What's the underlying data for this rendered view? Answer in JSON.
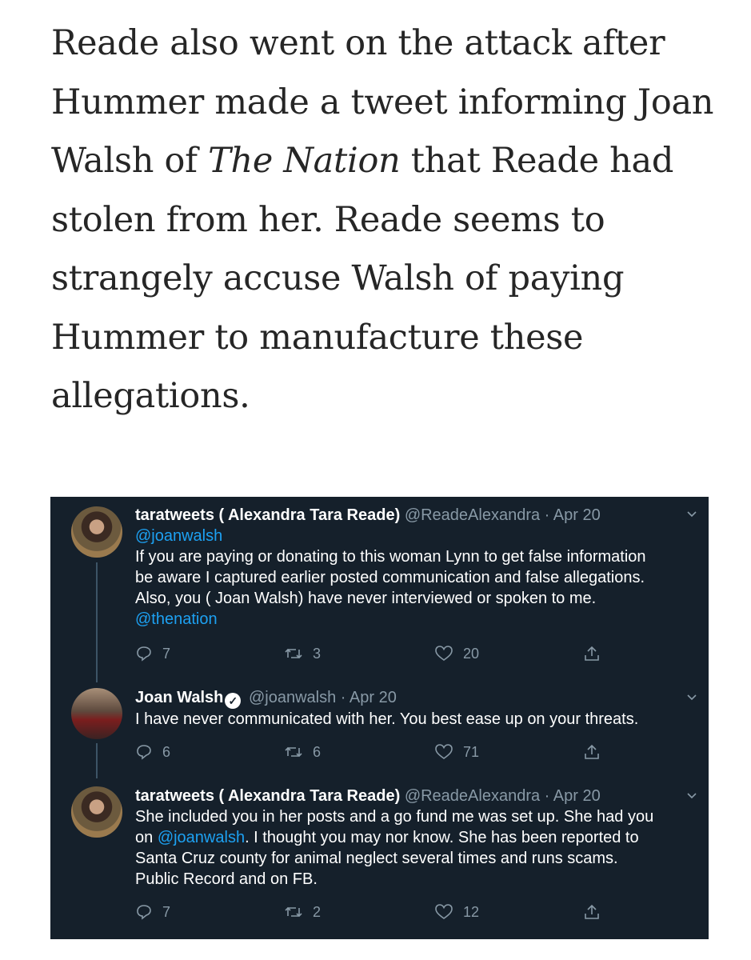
{
  "article": {
    "line1": "Reade also went on the attack after",
    "line2": "Hummer made a tweet informing Joan",
    "line3_pre": "Walsh of ",
    "line3_em": "The Nation",
    "line3_post": " that Reade had",
    "line4": "stolen from her. Reade seems to",
    "line5": "strangely accuse Walsh of paying",
    "line6": "Hummer to manufacture these",
    "line7": "allegations."
  },
  "tweets": [
    {
      "name": "taratweets ( Alexandra Tara Reade)",
      "handle": "@ReadeAlexandra",
      "dot": "·",
      "date": "Apr 20",
      "mention_top": "@joanwalsh",
      "body1": "If you are paying or donating to this woman Lynn to get false information",
      "body2": "be aware I captured earlier posted communication and false allegations.",
      "body3": "Also, you ( Joan Walsh)  have never interviewed or spoken to me.",
      "mention_bottom": "@thenation",
      "replies": "7",
      "retweets": "3",
      "likes": "20"
    },
    {
      "name": "Joan Walsh",
      "handle": "@joanwalsh",
      "dot": "·",
      "date": "Apr 20",
      "body1": "I have never communicated with her. You best ease up on your threats.",
      "replies": "6",
      "retweets": "6",
      "likes": "71"
    },
    {
      "name": "taratweets ( Alexandra Tara Reade)",
      "handle": "@ReadeAlexandra",
      "dot": "·",
      "date": "Apr 20",
      "body1": "She included you in her posts and a go fund me was set up. She had you",
      "body2_pre": "on ",
      "body2_mention": "@joanwalsh",
      "body2_post": ". I thought you may nor know. She has been reported to",
      "body3": "Santa Cruz county for animal neglect several times and runs scams.",
      "body4": "Public Record and on FB.",
      "replies": "7",
      "retweets": "2",
      "likes": "12"
    }
  ],
  "colors": {
    "card_bg": "#15202b",
    "link": "#1da1f2",
    "muted": "#8899a6",
    "thread_line": "#3d5466"
  },
  "icons": [
    "reply-icon",
    "retweet-icon",
    "like-icon",
    "share-icon",
    "chevron-down-icon",
    "verified-badge-icon"
  ]
}
